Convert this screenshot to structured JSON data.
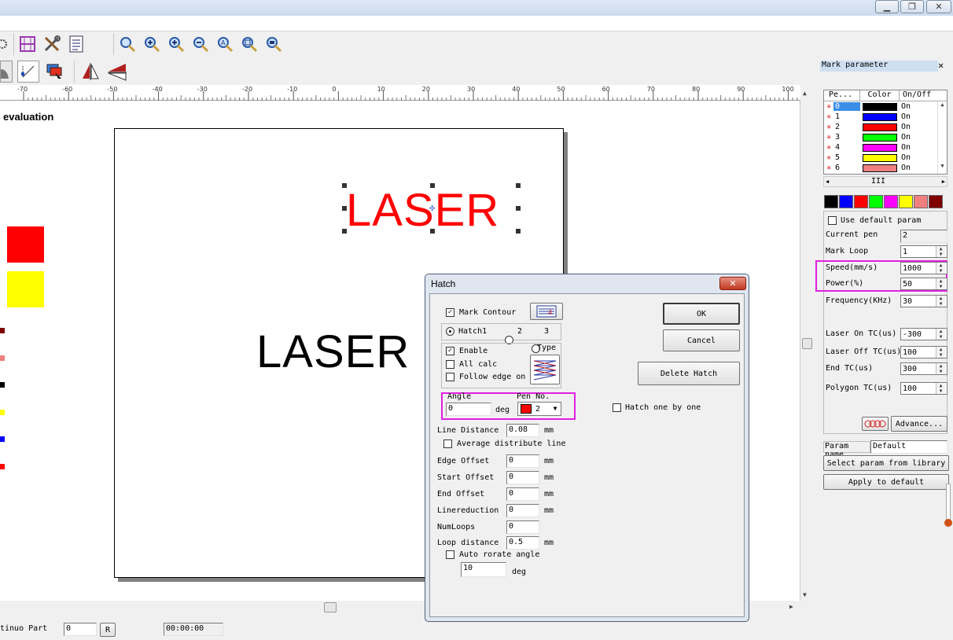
{
  "window": {
    "minimize_icon": "minimize-icon",
    "restore_icon": "restore-icon",
    "close_icon": "close-icon"
  },
  "toolbar": {
    "icons_row1": [
      "gear-icon",
      "hatch-icon",
      "tools-icon",
      "list-icon",
      "zoom-icon",
      "zoom-in-icon",
      "zoom-in-alt-icon",
      "zoom-out-icon",
      "zoom-fit-icon",
      "zoom-all-icon",
      "zoom-select-icon"
    ],
    "icons_row2": [
      "shape-icon",
      "node-icon",
      "layers-icon",
      "mirror-horizontal-icon",
      "mirror-vertical-icon"
    ]
  },
  "ruler": {
    "ticks": [
      "-70",
      "-60",
      "-50",
      "-40",
      "-30",
      "-20",
      "-10",
      "0",
      "10",
      "20",
      "30",
      "40",
      "50",
      "60",
      "70",
      "80",
      "90",
      "100"
    ]
  },
  "canvas": {
    "banner": "evaluation",
    "red_text": "LASER",
    "black_text": "LASER",
    "swatch_colors": [
      "#ff0000",
      "#ffff00"
    ],
    "dot_colors": [
      "#800000",
      "#f08080",
      "#000000",
      "#ffff00",
      "#0000ff",
      "#ff0000"
    ]
  },
  "status": {
    "label": "tinuo Part",
    "part_value": "0",
    "r_button": "R",
    "time": "00:00:00"
  },
  "panel": {
    "title": "Mark parameter",
    "columns": [
      "Pe...",
      "Color",
      "On/Off"
    ],
    "pens": [
      {
        "no": "0",
        "color": "#000000",
        "state": "On"
      },
      {
        "no": "1",
        "color": "#0000ff",
        "state": "On"
      },
      {
        "no": "2",
        "color": "#ff0000",
        "state": "On"
      },
      {
        "no": "3",
        "color": "#00ff00",
        "state": "On"
      },
      {
        "no": "4",
        "color": "#ff00ff",
        "state": "On"
      },
      {
        "no": "5",
        "color": "#ffff00",
        "state": "On"
      },
      {
        "no": "6",
        "color": "#f08080",
        "state": "On"
      }
    ],
    "hscroll_grip": "III",
    "palette": [
      "#000000",
      "#0000ff",
      "#ff0000",
      "#00ff00",
      "#ff00ff",
      "#ffff00",
      "#f08080",
      "#800000"
    ],
    "use_default": "Use default param",
    "current_pen_label": "Current pen",
    "current_pen_value": "2",
    "mark_loop_label": "Mark Loop",
    "mark_loop_value": "1",
    "speed_label": "Speed(mm/s)",
    "speed_value": "1000",
    "power_label": "Power(%)",
    "power_value": "50",
    "frequency_label": "Frequency(KHz)",
    "frequency_value": "30",
    "laser_on_label": "Laser On TC(us)",
    "laser_on_value": "-300",
    "laser_off_label": "Laser Off TC(us)",
    "laser_off_value": "100",
    "end_tc_label": "End TC(us)",
    "end_tc_value": "300",
    "polygon_tc_label": "Polygon TC(us)",
    "polygon_tc_value": "100",
    "advance_button": "Advance...",
    "param_name_label": "Param name",
    "param_name_value": "Default",
    "select_library_button": "Select param from library",
    "apply_default_button": "Apply to default"
  },
  "hatch": {
    "title": "Hatch",
    "mark_contour": "Mark Contour",
    "hatch1": "Hatch1",
    "hatch2": "2",
    "hatch3": "3",
    "enable": "Enable",
    "type_label": "Type",
    "all_calc": "All calc",
    "follow_edge": "Follow edge on",
    "angle_label": "Angle",
    "angle_value": "0",
    "angle_unit": "deg",
    "pen_label": "Pen No.",
    "pen_value": "2",
    "pen_color": "#ff0000",
    "line_distance_label": "Line Distance",
    "line_distance_value": "0.08",
    "avg_distribute": "Average distribute line",
    "edge_offset_label": "Edge Offset",
    "edge_offset_value": "0",
    "start_offset_label": "Start Offset",
    "start_offset_value": "0",
    "end_offset_label": "End Offset",
    "end_offset_value": "0",
    "linereduction_label": "Linereduction",
    "linereduction_value": "0",
    "numloops_label": "NumLoops",
    "numloops_value": "0",
    "loop_distance_label": "Loop distance",
    "loop_distance_value": "0.5",
    "auto_rotate": "Auto rorate angle",
    "auto_rotate_value": "10",
    "deg_unit": "deg",
    "mm_unit": "mm",
    "ok_button": "OK",
    "cancel_button": "Cancel",
    "delete_button": "Delete Hatch",
    "hatch_one_by_one": "Hatch one by one"
  }
}
